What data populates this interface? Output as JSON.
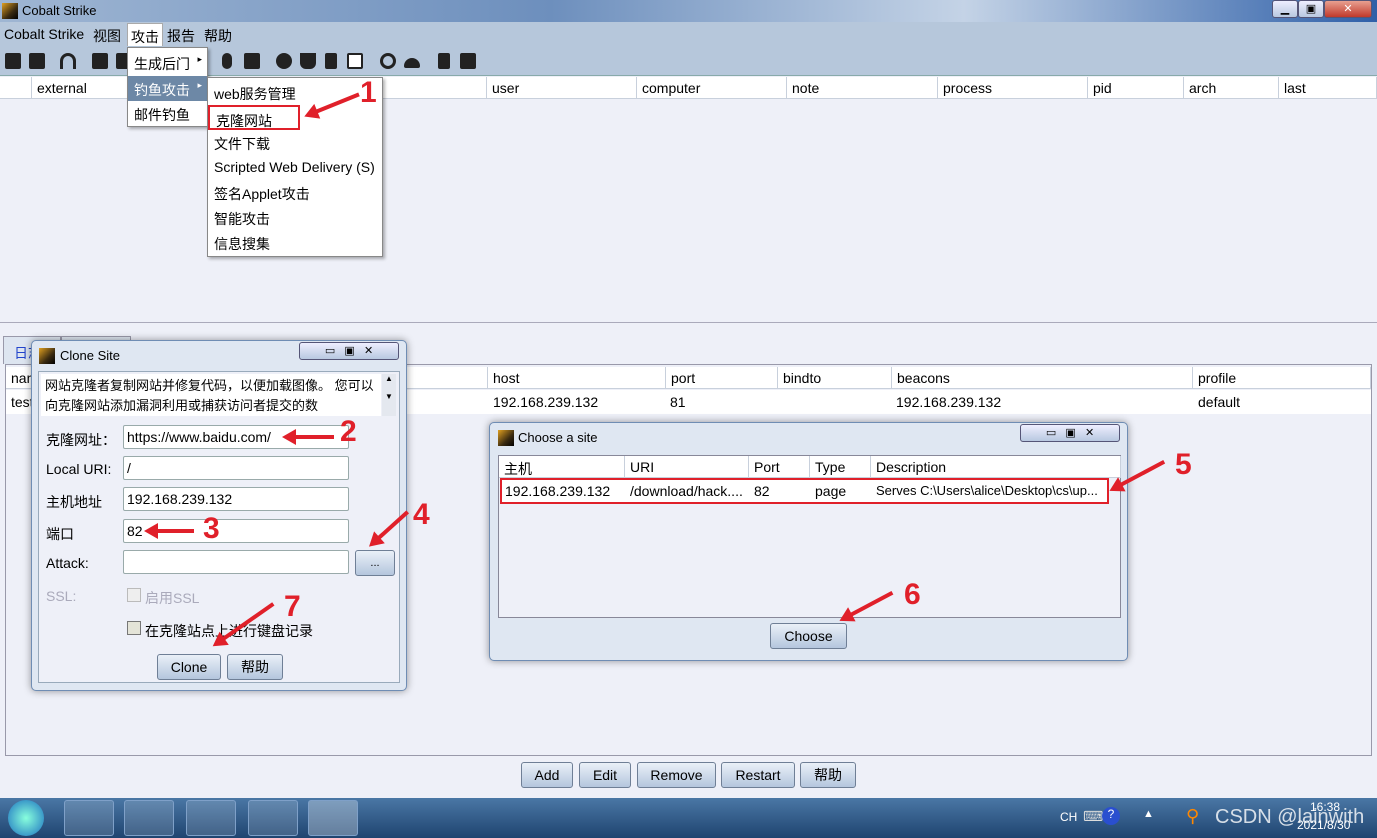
{
  "window": {
    "title": "Cobalt Strike"
  },
  "menubar": [
    "Cobalt Strike",
    "视图",
    "攻击",
    "报告",
    "帮助"
  ],
  "attack_menu": {
    "items": [
      "生成后门",
      "钓鱼攻击",
      "邮件钓鱼"
    ],
    "selected": "钓鱼攻击"
  },
  "phish_submenu": [
    "web服务管理",
    "克隆网站",
    "文件下载",
    "Scripted Web Delivery (S)",
    "签名Applet攻击",
    "智能攻击",
    "信息搜集"
  ],
  "beacon_table": {
    "columns": [
      "external",
      "user",
      "computer",
      "note",
      "process",
      "pid",
      "arch",
      "last"
    ]
  },
  "bottom_tabs": [
    "日志"
  ],
  "sites_table": {
    "columns": [
      "name",
      "host",
      "port",
      "bindto",
      "beacons",
      "profile"
    ],
    "rows": [
      [
        "test",
        "192.168.239.132",
        "81",
        "",
        "192.168.239.132",
        "default"
      ]
    ]
  },
  "bottom_buttons": [
    "Add",
    "Edit",
    "Remove",
    "Restart",
    "帮助"
  ],
  "clone_dialog": {
    "title": "Clone Site",
    "description": "网站克隆者复制网站并修复代码，以便加载图像。 您可以向克隆网站添加漏洞利用或捕获访问者提交的数",
    "fields": [
      {
        "label": "克隆网址：",
        "value": "https://www.baidu.com/"
      },
      {
        "label": "Local URI:",
        "value": "/"
      },
      {
        "label": "主机地址",
        "value": "192.168.239.132"
      },
      {
        "label": "端口",
        "value": "82"
      },
      {
        "label": "Attack:",
        "value": ""
      }
    ],
    "browse_label": "...",
    "ssl_label": "SSL:",
    "ssl_checkbox": "启用SSL",
    "keylog_checkbox": "在克隆站点上进行键盘记录",
    "clone_button": "Clone",
    "help_button": "帮助"
  },
  "choose_dialog": {
    "title": "Choose a site",
    "columns": [
      "主机",
      "URI",
      "Port",
      "Type",
      "Description"
    ],
    "rows": [
      [
        "192.168.239.132",
        "/download/hack....",
        "82",
        "page",
        "Serves C:\\Users\\alice\\Desktop\\cs\\up..."
      ]
    ],
    "choose_button": "Choose"
  },
  "annotations": [
    "1",
    "2",
    "3",
    "4",
    "5",
    "6",
    "7"
  ],
  "taskbar": {
    "lang": "CH",
    "time": "16:38",
    "date": "2021/8/30",
    "watermark": "CSDN @lainwith"
  },
  "colors": {
    "annotation": "#e0202a",
    "menu_selected": "#6d88a6",
    "menubar": "#b6c7db"
  }
}
